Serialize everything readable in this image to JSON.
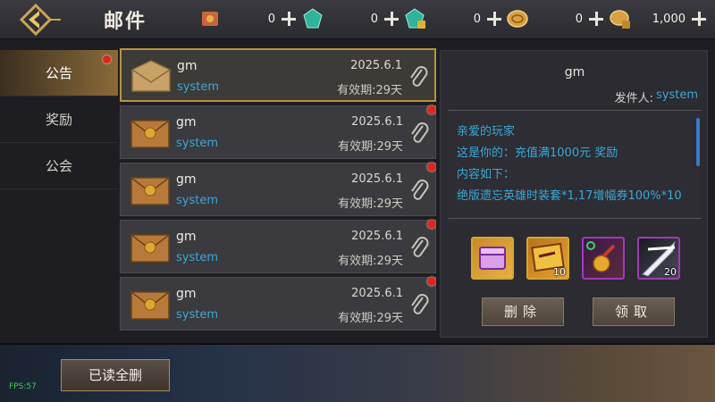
{
  "header": {
    "title": "邮件",
    "resources": [
      {
        "icon": "scroll-icon",
        "value": "0"
      },
      {
        "icon": "green-gem-icon",
        "value": "0"
      },
      {
        "icon": "locked-gem-icon",
        "value": "0"
      },
      {
        "icon": "gold-coin-icon",
        "value": "0"
      },
      {
        "icon": "locked-coin-icon",
        "value": "1,000"
      }
    ]
  },
  "tabs": [
    {
      "label": "公告",
      "active": true,
      "badge": true
    },
    {
      "label": "奖励",
      "active": false,
      "badge": false
    },
    {
      "label": "公会",
      "active": false,
      "badge": false
    }
  ],
  "mails": [
    {
      "sender": "gm",
      "from": "system",
      "date": "2025.6.1",
      "expiry": "有效期:29天",
      "opened": true,
      "unread": false
    },
    {
      "sender": "gm",
      "from": "system",
      "date": "2025.6.1",
      "expiry": "有效期:29天",
      "opened": false,
      "unread": true
    },
    {
      "sender": "gm",
      "from": "system",
      "date": "2025.6.1",
      "expiry": "有效期:29天",
      "opened": false,
      "unread": true
    },
    {
      "sender": "gm",
      "from": "system",
      "date": "2025.6.1",
      "expiry": "有效期:29天",
      "opened": false,
      "unread": true
    },
    {
      "sender": "gm",
      "from": "system",
      "date": "2025.6.1",
      "expiry": "有效期:29天",
      "opened": false,
      "unread": true
    }
  ],
  "detail": {
    "title": "gm",
    "sender_label": "发件人:",
    "sender": "system",
    "body": [
      "亲爱的玩家",
      "这是你的：充值满1000元 奖励",
      "内容如下：",
      "绝版遗忘英雄时装套*1,17增幅券100%*10"
    ],
    "attachments": [
      {
        "icon": "purple-chest-icon",
        "qty": ""
      },
      {
        "icon": "plus17-ticket-icon",
        "qty": "10"
      },
      {
        "icon": "gold-pendant-icon",
        "qty": ""
      },
      {
        "icon": "black-blade-icon",
        "qty": "20"
      }
    ],
    "delete_label": "删除",
    "claim_label": "领取"
  },
  "footer": {
    "read_all_delete_label": "已读全删",
    "fps": "FPS:57"
  },
  "colors": {
    "accent_blue": "#3aa8d8",
    "gold_border": "#b8943e",
    "badge_red": "#e0261c"
  }
}
